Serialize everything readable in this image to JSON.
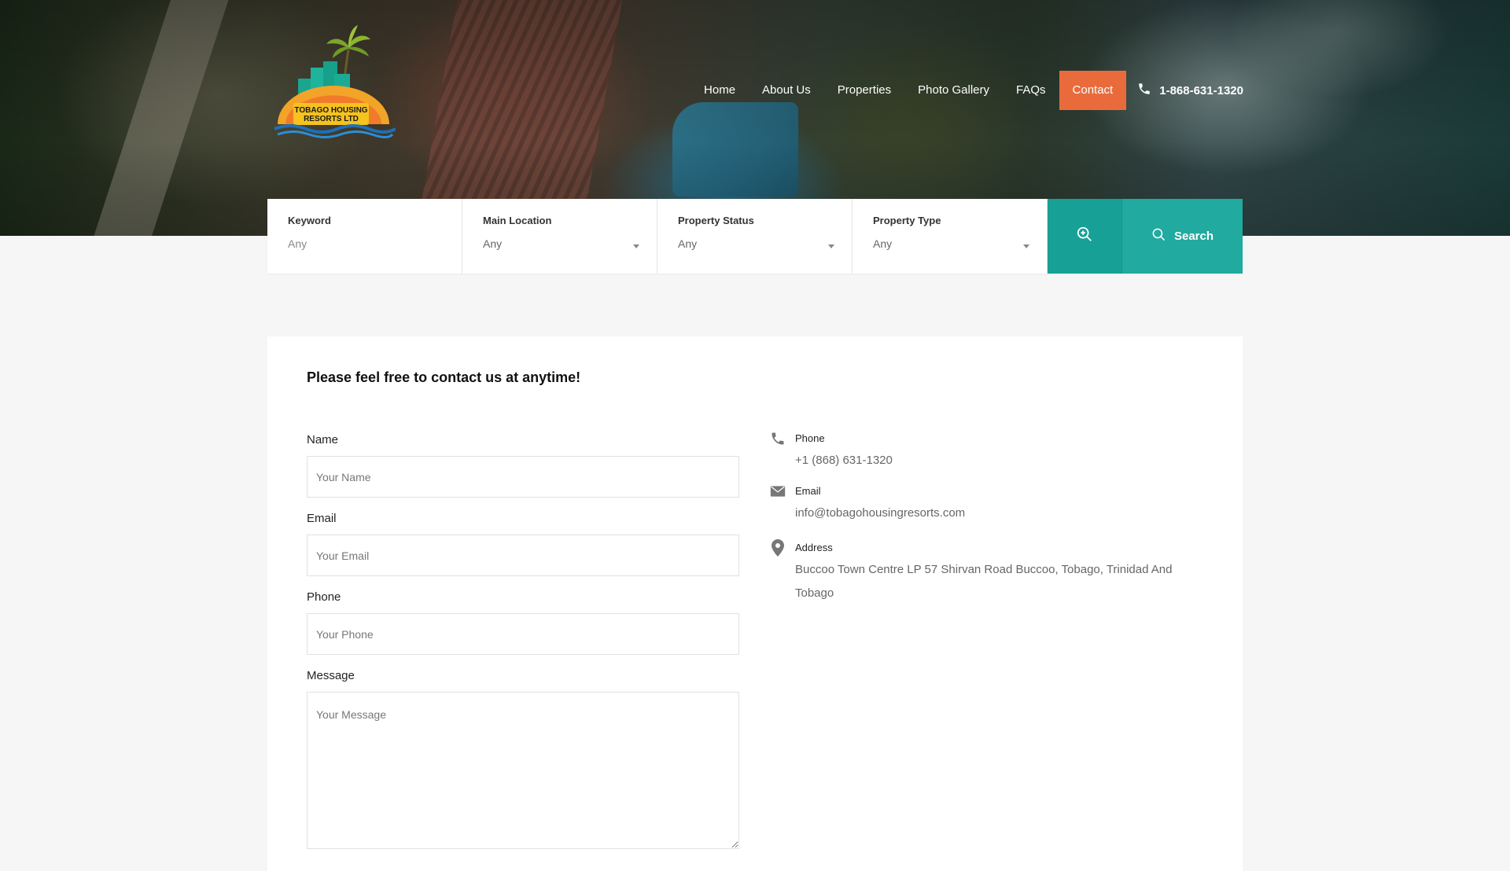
{
  "brand": {
    "logo_text_line1": "TOBAGO HOUSING",
    "logo_text_line2": "RESORTS LTD"
  },
  "nav": {
    "items": [
      {
        "label": "Home",
        "active": false
      },
      {
        "label": "About Us",
        "active": false
      },
      {
        "label": "Properties",
        "active": false
      },
      {
        "label": "Photo Gallery",
        "active": false
      },
      {
        "label": "FAQs",
        "active": false
      },
      {
        "label": "Contact",
        "active": true
      }
    ],
    "phone": "1-868-631-1320",
    "phone_icon": "phone-icon"
  },
  "search": {
    "fields": [
      {
        "label": "Keyword",
        "value": "Any"
      },
      {
        "label": "Main Location",
        "value": "Any"
      },
      {
        "label": "Property Status",
        "value": "Any"
      },
      {
        "label": "Property Type",
        "value": "Any"
      }
    ],
    "advanced_icon": "zoom-in-icon",
    "button_label": "Search",
    "button_icon": "search-icon"
  },
  "contact": {
    "title": "Please feel free to contact us at anytime!",
    "form": {
      "name_label": "Name",
      "name_placeholder": "Your Name",
      "email_label": "Email",
      "email_placeholder": "Your Email",
      "phone_label": "Phone",
      "phone_placeholder": "Your Phone",
      "message_label": "Message",
      "message_placeholder": "Your Message"
    },
    "info": {
      "phone_label": "Phone",
      "phone_value": "+1 (868) 631-1320",
      "email_label": "Email",
      "email_value": "info@tobagohousingresorts.com",
      "address_label": "Address",
      "address_value": "Buccoo Town Centre LP 57 Shirvan Road Buccoo, Tobago, Trinidad And Tobago"
    }
  },
  "colors": {
    "accent_orange": "#e96b3c",
    "accent_teal": "#21aa9f",
    "page_bg": "#f6f6f6"
  }
}
